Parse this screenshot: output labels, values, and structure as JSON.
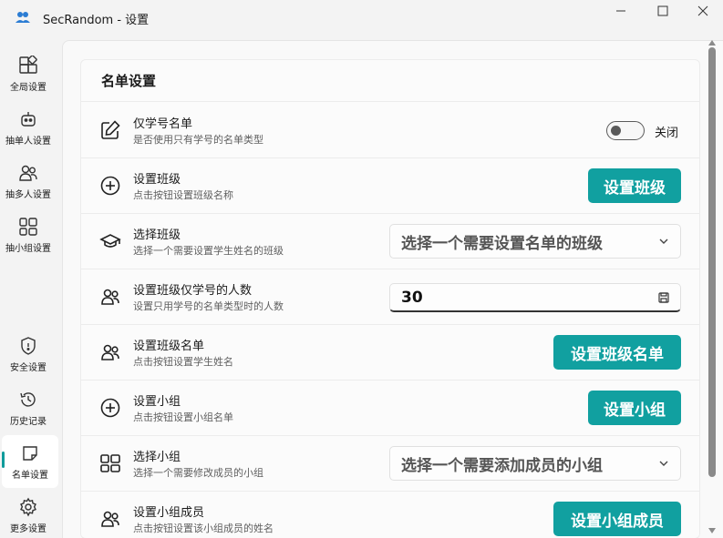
{
  "window": {
    "title": "SecRandom - 设置",
    "controls": {
      "minimize": "minimize-icon",
      "maximize": "maximize-icon",
      "close": "close-icon"
    }
  },
  "sidebar": {
    "items": [
      {
        "label": "全局设置",
        "icon": "global-settings-icon"
      },
      {
        "label": "抽单人设置",
        "icon": "robot-icon"
      },
      {
        "label": "抽多人设置",
        "icon": "people-icon"
      },
      {
        "label": "抽小组设置",
        "icon": "groups-grid-icon"
      },
      {
        "label": "安全设置",
        "icon": "shield-icon"
      },
      {
        "label": "历史记录",
        "icon": "history-icon"
      },
      {
        "label": "名单设置",
        "icon": "note-icon",
        "active": true
      },
      {
        "label": "更多设置",
        "icon": "gear-icon"
      }
    ]
  },
  "card": {
    "header": "名单设置",
    "rows": {
      "student_id_only": {
        "title": "仅学号名单",
        "desc": "是否使用只有学号的名单类型",
        "toggle_state": "关闭",
        "toggle_on": false,
        "icon": "edit-icon"
      },
      "set_class": {
        "title": "设置班级",
        "desc": "点击按钮设置班级名称",
        "button": "设置班级",
        "icon": "add-circle-icon"
      },
      "select_class": {
        "title": "选择班级",
        "desc": "选择一个需要设置学生姓名的班级",
        "placeholder": "选择一个需要设置名单的班级",
        "icon": "graduation-cap-icon"
      },
      "class_count": {
        "title": "设置班级仅学号的人数",
        "desc": "设置只用学号的名单类型时的人数",
        "value": "30",
        "icon": "people-icon"
      },
      "class_roster": {
        "title": "设置班级名单",
        "desc": "点击按钮设置学生姓名",
        "button": "设置班级名单",
        "icon": "people-icon"
      },
      "set_group": {
        "title": "设置小组",
        "desc": "点击按钮设置小组名单",
        "button": "设置小组",
        "icon": "add-circle-icon"
      },
      "select_group": {
        "title": "选择小组",
        "desc": "选择一个需要修改成员的小组",
        "placeholder": "选择一个需要添加成员的小组",
        "icon": "groups-grid-icon"
      },
      "group_members": {
        "title": "设置小组成员",
        "desc": "点击按钮设置该小组成员的姓名",
        "button": "设置小组成员",
        "icon": "people-icon"
      }
    }
  },
  "colors": {
    "accent": "#11a0a0",
    "background": "#f3f3f3",
    "card": "#fbfbfb"
  }
}
